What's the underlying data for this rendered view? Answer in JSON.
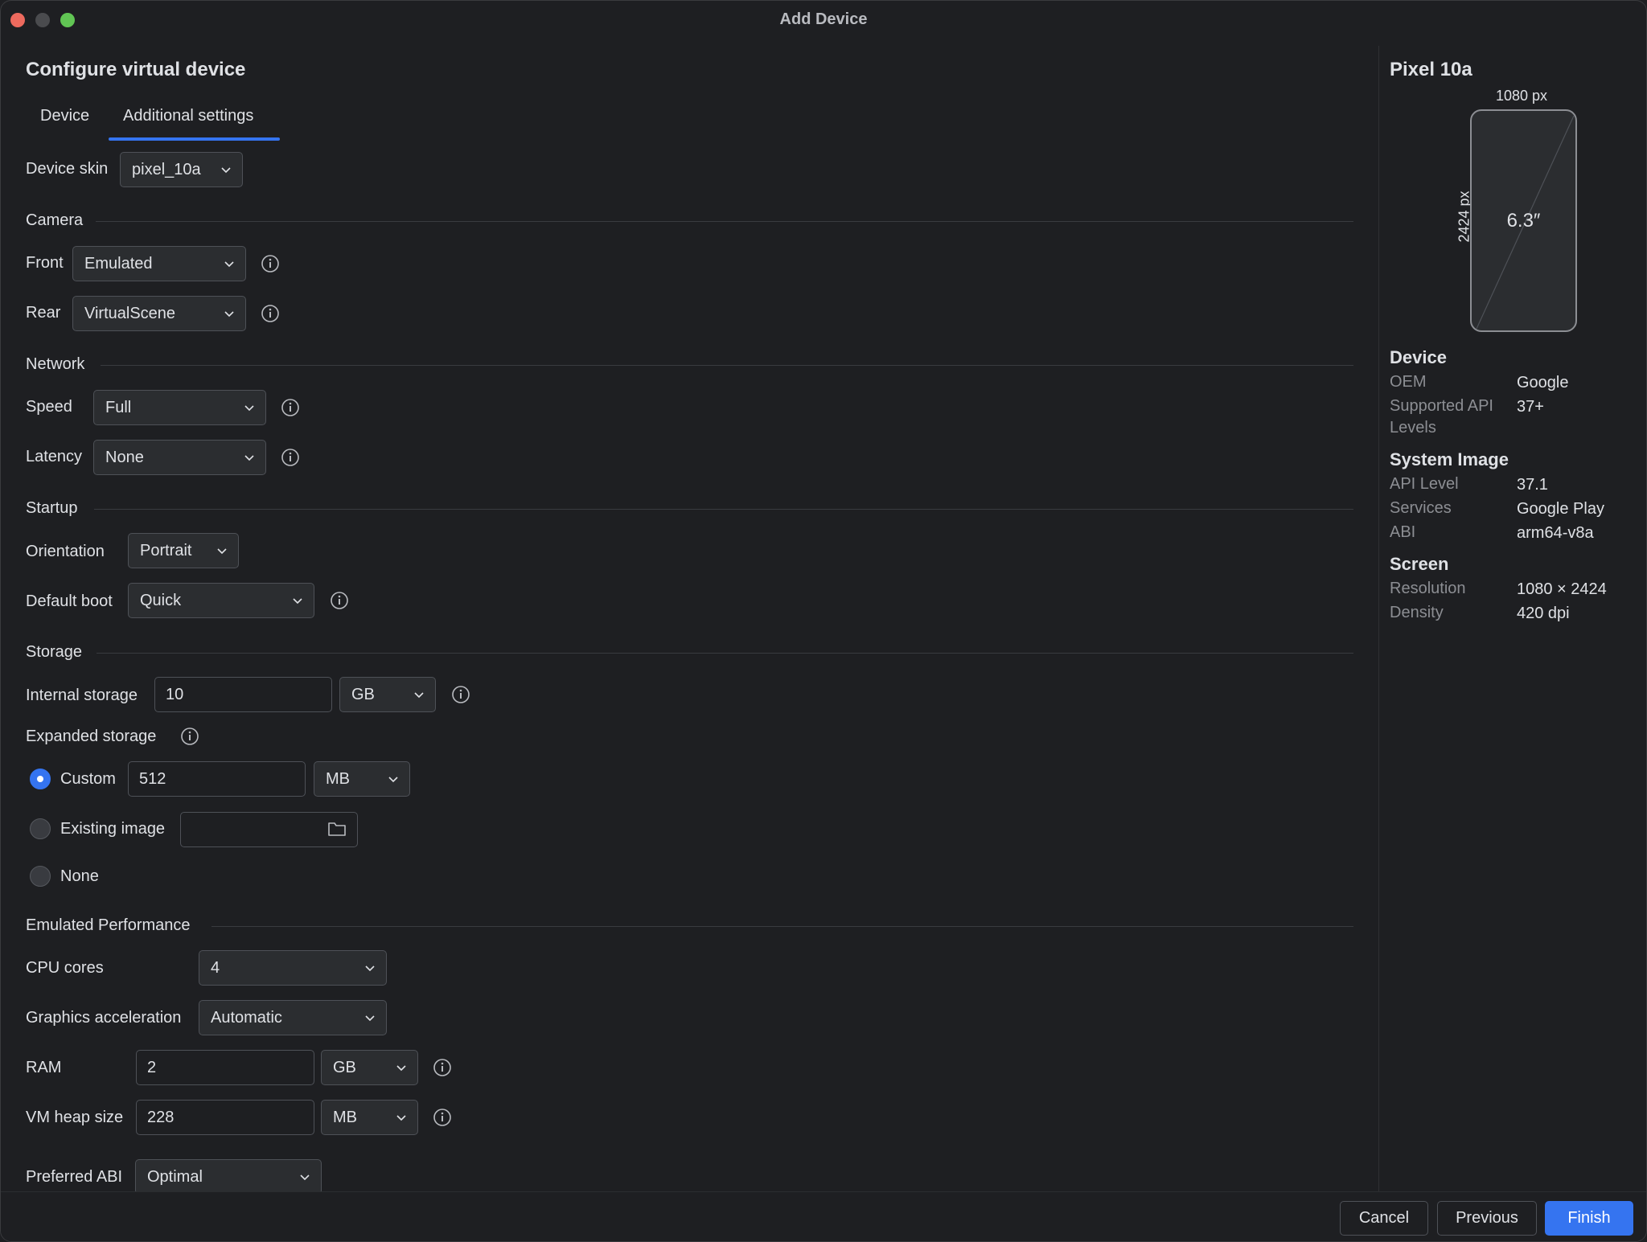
{
  "window": {
    "title": "Add Device"
  },
  "heading": "Configure virtual device",
  "tabs": [
    {
      "label": "Device",
      "selected": false
    },
    {
      "label": "Additional settings",
      "selected": true
    }
  ],
  "device_skin": {
    "label": "Device skin",
    "value": "pixel_10a"
  },
  "camera": {
    "section": "Camera",
    "front": {
      "label": "Front",
      "value": "Emulated"
    },
    "rear": {
      "label": "Rear",
      "value": "VirtualScene"
    }
  },
  "network": {
    "section": "Network",
    "speed": {
      "label": "Speed",
      "value": "Full"
    },
    "latency": {
      "label": "Latency",
      "value": "None"
    }
  },
  "startup": {
    "section": "Startup",
    "orientation": {
      "label": "Orientation",
      "value": "Portrait"
    },
    "default_boot": {
      "label": "Default boot",
      "value": "Quick"
    }
  },
  "storage": {
    "section": "Storage",
    "internal": {
      "label": "Internal storage",
      "value": "10",
      "unit": "GB"
    },
    "expanded": {
      "label": "Expanded storage",
      "custom": {
        "label": "Custom",
        "value": "512",
        "unit": "MB",
        "selected": true
      },
      "existing": {
        "label": "Existing image",
        "value": "",
        "selected": false
      },
      "none": {
        "label": "None",
        "selected": false
      }
    }
  },
  "performance": {
    "section": "Emulated Performance",
    "cpu": {
      "label": "CPU cores",
      "value": "4"
    },
    "graphics": {
      "label": "Graphics acceleration",
      "value": "Automatic"
    },
    "ram": {
      "label": "RAM",
      "value": "2",
      "unit": "GB"
    },
    "vm_heap": {
      "label": "VM heap size",
      "value": "228",
      "unit": "MB"
    },
    "abi": {
      "label": "Preferred ABI",
      "value": "Optimal"
    }
  },
  "preview": {
    "name": "Pixel 10a",
    "width_px": "1080 px",
    "height_px": "2424 px",
    "size": "6.3″",
    "device_section": "Device",
    "oem_label": "OEM",
    "oem_value": "Google",
    "api_label": "Supported API Levels",
    "api_value": "37+",
    "system_image_section": "System Image",
    "api_level_label": "API Level",
    "api_level_value": "37.1",
    "services_label": "Services",
    "services_value": "Google Play",
    "abi_label": "ABI",
    "abi_value": "arm64-v8a",
    "screen_section": "Screen",
    "resolution_label": "Resolution",
    "resolution_value": "1080 × 2424",
    "density_label": "Density",
    "density_value": "420 dpi"
  },
  "footer": {
    "cancel": "Cancel",
    "previous": "Previous",
    "finish": "Finish"
  },
  "colors": {
    "accent": "#3574f0",
    "background": "#1e1f22"
  }
}
